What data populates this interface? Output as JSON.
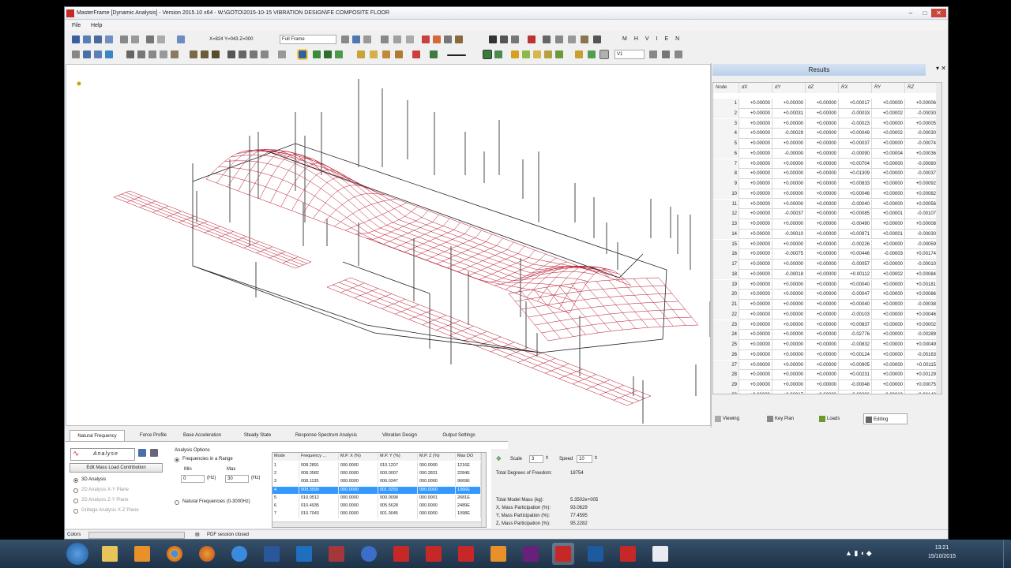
{
  "window": {
    "title": "MasterFrame [Dynamic Analysis] - Version 2015.10 x64 - W:\\GOTO\\2015-10-15 VIBRATION DESIGN\\FE COMPOSITE FLOOR",
    "minimize": "–",
    "maximize": "□",
    "close": "✕"
  },
  "menu": {
    "file": "File",
    "help": "Help"
  },
  "toolbar": {
    "coords": "X=824 Y=043 Z=000",
    "view_mode": "Full Frame",
    "letters": "MHVIEN",
    "combo2": "V1"
  },
  "results": {
    "title": "Results",
    "headers": [
      "Node",
      "dX",
      "dY",
      "dZ",
      "RX",
      "RY",
      "RZ"
    ],
    "rows": [
      [
        "1",
        "+0.00000",
        "+0.00000",
        "+0.00000",
        "+0.00017",
        "+0.00000",
        "+0.00006"
      ],
      [
        "2",
        "+0.00000",
        "+0.00031",
        "+0.00000",
        "-0.00033",
        "+0.00002",
        "-0.00030"
      ],
      [
        "3",
        "+0.00000",
        "+0.00000",
        "+0.00000",
        "-0.00023",
        "+0.00000",
        "+0.00005"
      ],
      [
        "4",
        "+0.00000",
        "-0.00029",
        "+0.00000",
        "+0.00049",
        "+0.00002",
        "-0.00030"
      ],
      [
        "5",
        "+0.00000",
        "+0.00000",
        "+0.00000",
        "+0.00037",
        "+0.00000",
        "-0.00074"
      ],
      [
        "6",
        "+0.00000",
        "-0.00000",
        "+0.00000",
        "-0.00090",
        "+0.00004",
        "+0.00036"
      ],
      [
        "7",
        "+0.00000",
        "+0.00000",
        "+0.00000",
        "+0.00704",
        "+0.00000",
        "-0.00080"
      ],
      [
        "8",
        "+0.00000",
        "+0.00000",
        "+0.00000",
        "+0.01309",
        "+0.00000",
        "-0.00037"
      ],
      [
        "9",
        "+0.00000",
        "+0.00000",
        "+0.00000",
        "+0.00833",
        "+0.00000",
        "+0.00092"
      ],
      [
        "10",
        "+0.00000",
        "+0.00000",
        "+0.00000",
        "+0.00046",
        "+0.00000",
        "+0.00082"
      ],
      [
        "11",
        "+0.00000",
        "+0.00000",
        "+0.00000",
        "-0.00040",
        "+0.00000",
        "+0.00056"
      ],
      [
        "12",
        "+0.00000",
        "-0.00037",
        "+0.00000",
        "+0.00085",
        "+0.00001",
        "-0.00107"
      ],
      [
        "13",
        "+0.00000",
        "+0.00000",
        "+0.00000",
        "-0.00490",
        "+0.00000",
        "+0.00008"
      ],
      [
        "14",
        "+0.00000",
        "-0.00010",
        "+0.00000",
        "+0.00971",
        "+0.00001",
        "-0.00030"
      ],
      [
        "15",
        "+0.00000",
        "+0.00000",
        "+0.00000",
        "-0.00226",
        "+0.00000",
        "-0.00059"
      ],
      [
        "16",
        "+0.00000",
        "-0.00075",
        "+0.00000",
        "+0.00446",
        "-0.00003",
        "+0.00174"
      ],
      [
        "17",
        "+0.00000",
        "+0.00000",
        "+0.00000",
        "-0.00057",
        "+0.00000",
        "-0.00010"
      ],
      [
        "18",
        "+0.00000",
        "-0.00018",
        "+0.00000",
        "+0.00112",
        "+0.00002",
        "+0.00084"
      ],
      [
        "19",
        "+0.00000",
        "+0.00000",
        "+0.00000",
        "+0.00040",
        "+0.00000",
        "+0.00181"
      ],
      [
        "20",
        "+0.00000",
        "+0.00000",
        "+0.00000",
        "-0.00047",
        "+0.00000",
        "+0.00086"
      ],
      [
        "21",
        "+0.00000",
        "+0.00000",
        "+0.00000",
        "+0.00040",
        "+0.00000",
        "-0.00038"
      ],
      [
        "22",
        "+0.00000",
        "+0.00000",
        "+0.00000",
        "-0.00103",
        "+0.00000",
        "+0.00046"
      ],
      [
        "23",
        "+0.00000",
        "+0.00000",
        "+0.00000",
        "+0.00837",
        "+0.00000",
        "+0.00002"
      ],
      [
        "24",
        "+0.00000",
        "+0.00000",
        "+0.00000",
        "-0.02776",
        "+0.00000",
        "-0.00289"
      ],
      [
        "25",
        "+0.00000",
        "+0.00000",
        "+0.00000",
        "-0.00832",
        "+0.00000",
        "+0.00049"
      ],
      [
        "26",
        "+0.00000",
        "+0.00000",
        "+0.00000",
        "+0.00124",
        "+0.00000",
        "-0.00163"
      ],
      [
        "27",
        "+0.00000",
        "+0.00000",
        "+0.00000",
        "+0.00905",
        "+0.00000",
        "+0.00115"
      ],
      [
        "28",
        "+0.00000",
        "+0.00000",
        "+0.00000",
        "+0.00231",
        "+0.00000",
        "+0.00129"
      ],
      [
        "29",
        "+0.00000",
        "+0.00000",
        "+0.00000",
        "-0.00048",
        "+0.00000",
        "+0.00075"
      ],
      [
        "30",
        "+0.00000",
        "+0.00017",
        "+0.00000",
        "+0.00096",
        "-0.00010",
        "+0.00143"
      ]
    ],
    "tabs": [
      "Viewing",
      "Key Plan",
      "Loads",
      "Editing"
    ]
  },
  "bottom": {
    "tabs": [
      "Natural Frequency",
      "Force Profile",
      "Base Acceleration",
      "Steady State",
      "Response Spectrum Analysis",
      "Vibration Design",
      "Output Settings"
    ],
    "analyse_label": "Analyse",
    "edit_mass_btn": "Edit Mass Load Contribution",
    "analysis_types": [
      "3D Analysis",
      "2D Analysis X-Y Plane",
      "2D Analysis Z-Y Plane",
      "Grillage Analysis X-Z Plane"
    ],
    "options_title": "Analysis Options",
    "opt_range": "Frequencies in a Range",
    "min_label": "Min",
    "max_label": "Max",
    "min_val": "0",
    "max_val": "30",
    "hz": "(Hz)",
    "opt_natural": "Natural Frequencies (0-3000Hz)",
    "modes_headers": [
      "Mode",
      "Frequency ...",
      "M.P. X (%)",
      "M.P. Y (%)",
      "M.P. Z (%)",
      "Max DO"
    ],
    "modes_rows": [
      [
        "1",
        "008.2891",
        "000.0000",
        "010.1207",
        "000.0000",
        "1216E"
      ],
      [
        "2",
        "008.3582",
        "000.0000",
        "000.0007",
        "000.2831",
        "2284E"
      ],
      [
        "3",
        "008.1135",
        "000.0000",
        "006.0347",
        "000.0000",
        "9669E"
      ],
      [
        "4",
        "009.3590",
        "000.0000",
        "001.0250",
        "000.0000",
        "1366E"
      ],
      [
        "5",
        "010.0512",
        "000.0000",
        "000.0098",
        "000.0001",
        "2681E"
      ],
      [
        "6",
        "010.4935",
        "000.0000",
        "005.5628",
        "000.0000",
        "2489E"
      ],
      [
        "7",
        "010.7043",
        "000.0000",
        "001.0045",
        "000.0000",
        "1098E"
      ]
    ],
    "scale_label": "Scale",
    "scale_val": "3",
    "speed_label": "Speed",
    "speed_val": "10",
    "total_dof_label": "Total Degrees of Freedom:",
    "total_dof_val": "18754",
    "total_mass_label": "Total Model Mass (kg):",
    "total_mass_val": "5.3502e+005",
    "x_mass_label": "X, Mass Participation (%):",
    "x_mass_val": "93.0629",
    "y_mass_label": "Y, Mass Participation (%):",
    "y_mass_val": "77.4595",
    "z_mass_label": "Z, Mass Participation (%):",
    "z_mass_val": "95.2282"
  },
  "status": {
    "colors_label": "Colors",
    "pdf": "PDF session closed"
  },
  "taskbar": {
    "time": "13:21",
    "date": "15/10/2015"
  }
}
